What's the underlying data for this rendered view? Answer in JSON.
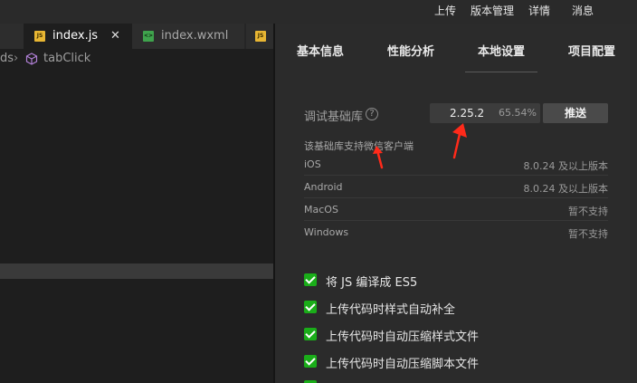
{
  "top_menu": {
    "upload": "上传",
    "version_manage": "版本管理",
    "details": "详情",
    "messages": "消息"
  },
  "editor": {
    "tabs": [
      {
        "label": "index.js",
        "icon": "js-file-icon",
        "active": true
      },
      {
        "label": "index.wxml",
        "icon": "wxml-file-icon",
        "active": false
      }
    ],
    "breadcrumb": {
      "partial": "ds",
      "symbol": "tabClick"
    }
  },
  "panel": {
    "tabs": [
      "基本信息",
      "性能分析",
      "本地设置",
      "项目配置"
    ],
    "active_tab": "本地设置",
    "debug_lib": {
      "label": "调试基础库",
      "version": "2.25.2",
      "coverage": "65.54%",
      "push_label": "推送"
    },
    "support_note": "该基础库支持微信客户端",
    "platforms": [
      {
        "name": "iOS",
        "requirement": "8.0.24 及以上版本"
      },
      {
        "name": "Android",
        "requirement": "8.0.24 及以上版本"
      },
      {
        "name": "MacOS",
        "requirement": "暂不支持"
      },
      {
        "name": "Windows",
        "requirement": "暂不支持"
      }
    ],
    "options": [
      {
        "label": "将 JS 编译成 ES5",
        "checked": true
      },
      {
        "label": "上传代码时样式自动补全",
        "checked": true
      },
      {
        "label": "上传代码时自动压缩样式文件",
        "checked": true
      },
      {
        "label": "上传代码时自动压缩脚本文件",
        "checked": true
      }
    ]
  },
  "colors": {
    "accent_green": "#1aad19",
    "annotation_red": "#ff2a1a",
    "panel_bg": "#2b2b2b",
    "editor_bg": "#1e1e1e"
  }
}
